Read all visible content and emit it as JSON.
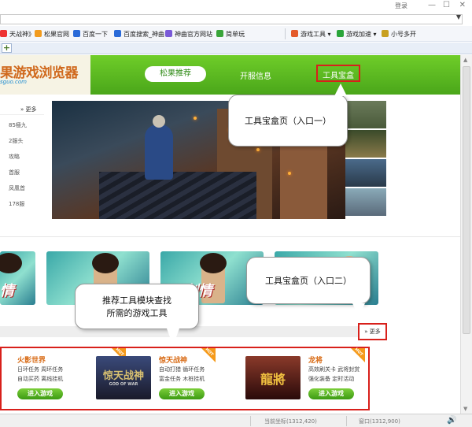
{
  "window": {
    "login_label": "登录",
    "minimize_glyph": "—",
    "maximize_glyph": "☐",
    "close_glyph": "✕"
  },
  "address_bar": {
    "dropdown_glyph": "▼"
  },
  "bookmarks": {
    "items": [
      {
        "label": "天战神》",
        "icon_color": "#e33"
      },
      {
        "label": "松果官网",
        "icon_color": "#f29b1d"
      },
      {
        "label": "百度一下",
        "icon_color": "#2a6ad8"
      },
      {
        "label": "百度搜索_神曲",
        "icon_color": "#2a6ad8"
      },
      {
        "label": "神曲官方网站",
        "icon_color": "#7a5ad8"
      },
      {
        "label": "简单玩",
        "icon_color": "#3aa53a"
      }
    ],
    "tools": [
      {
        "label": "游戏工具",
        "icon_color": "#e45a2a"
      },
      {
        "label": "游戏加速",
        "icon_color": "#2aa53a"
      },
      {
        "label": "小号多开",
        "icon_color": "#c8a020"
      }
    ]
  },
  "tabs": {
    "add_label": "+"
  },
  "site": {
    "logo_text": "果游戏浏览器",
    "logo_sub": "sguo.com",
    "nav": {
      "recommend": "松果推荐",
      "server_info": "开服信息",
      "toolbox": "工具宝盒"
    }
  },
  "sidebar": {
    "more_label": "» 更多",
    "items": [
      "85極九",
      "2服头",
      "攻略",
      "首服",
      "凤凰首",
      "178服"
    ]
  },
  "callouts": {
    "entry_one": "工具宝盒页（入口一）",
    "entry_two": "工具宝盒页（入口二）",
    "recommend_line1": "推荐工具模块查找",
    "recommend_line2": "所需的游戏工具"
  },
  "cards": [
    {
      "title": "情"
    },
    {
      "title": ""
    },
    {
      "title": "剑情"
    },
    {
      "title": ""
    }
  ],
  "more_button": "» 更多",
  "games": [
    {
      "name": "火影世界",
      "desc1": "日环任务  周环任务",
      "desc2": "自动买药  离线挂机",
      "enter": "进入游戏",
      "art_color": "#e6a04a",
      "hot": "HOT"
    },
    {
      "name": "惊天战神",
      "desc1": "自动打猎  循环任务",
      "desc2": "富金任务  木桩挂机",
      "enter": "进入游戏",
      "art_color": "#2a3a5a",
      "art_text": "惊天战神",
      "art_sub": "GOD OF WAR",
      "hot": "HOT"
    },
    {
      "name": "龙将",
      "desc1": "高效刷关卡  武将封赏",
      "desc2": "强化装备  定时活动",
      "enter": "进入游戏",
      "art_color": "#5a1a1a",
      "art_text": "龍將",
      "hot": "HOT"
    }
  ],
  "statusbar": {
    "pos_label": "当前坐标(1312,420)",
    "win_label": "窗口(1312,900)",
    "speaker_glyph": "🔊"
  },
  "colors": {
    "header_green": "#5ab820",
    "highlight_red": "#d8201b",
    "orange_accent": "#d86a14"
  }
}
